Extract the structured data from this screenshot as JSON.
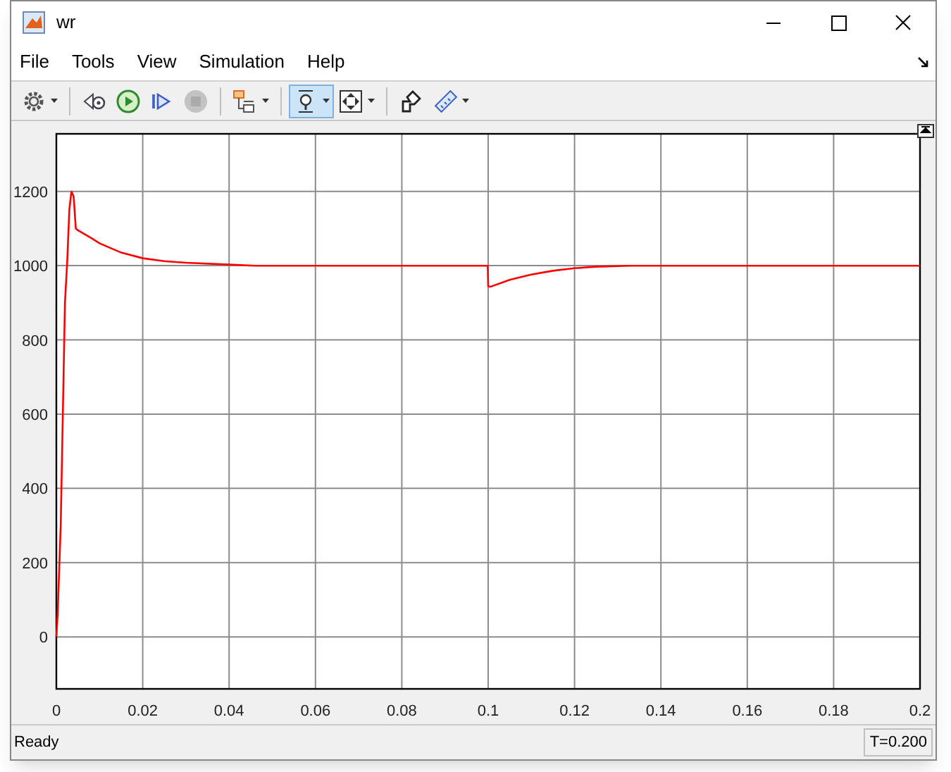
{
  "window": {
    "title": "wr"
  },
  "menu": [
    {
      "label": "File"
    },
    {
      "label": "Tools"
    },
    {
      "label": "View"
    },
    {
      "label": "Simulation"
    },
    {
      "label": "Help"
    }
  ],
  "toolbar": [
    [
      {
        "kind": "settings",
        "dropdown": true,
        "selected": false
      }
    ],
    [
      {
        "kind": "step-back",
        "dropdown": false,
        "selected": false
      },
      {
        "kind": "run",
        "dropdown": false,
        "selected": false
      },
      {
        "kind": "step-forward",
        "dropdown": false,
        "selected": false
      },
      {
        "kind": "stop",
        "dropdown": false,
        "selected": false,
        "disabled": true
      }
    ],
    [
      {
        "kind": "blocks",
        "dropdown": true,
        "selected": false
      }
    ],
    [
      {
        "kind": "zoom",
        "dropdown": true,
        "selected": true
      },
      {
        "kind": "fit",
        "dropdown": true,
        "selected": false
      }
    ],
    [
      {
        "kind": "highlight",
        "dropdown": false,
        "selected": false
      },
      {
        "kind": "measure",
        "dropdown": true,
        "selected": false
      }
    ]
  ],
  "plot": {
    "chart_data": {
      "type": "line",
      "x": [
        0,
        0.0003,
        0.001,
        0.0015,
        0.002,
        0.0025,
        0.003,
        0.0035,
        0.004,
        0.0045,
        0.005,
        0.008,
        0.01,
        0.015,
        0.02,
        0.025,
        0.03,
        0.04,
        0.046,
        0.0999,
        0.1,
        0.1005,
        0.105,
        0.11,
        0.115,
        0.12,
        0.125,
        0.133,
        0.2
      ],
      "series": [
        {
          "color": "#ff0000",
          "values": [
            0,
            60,
            300,
            600,
            900,
            1010,
            1150,
            1200,
            1185,
            1100,
            1095,
            1075,
            1060,
            1035,
            1020,
            1012,
            1008,
            1003,
            1000,
            1000,
            945,
            943,
            962,
            976,
            986,
            993,
            997,
            1000,
            1000
          ]
        }
      ],
      "grid": true,
      "xlim": [
        0,
        0.2
      ],
      "ylim": [
        -140,
        1355
      ],
      "xticks": [
        0,
        0.02,
        0.04,
        0.06,
        0.08,
        0.1,
        0.12,
        0.14,
        0.16,
        0.18,
        0.2
      ],
      "yticks": [
        0,
        200,
        400,
        600,
        800,
        1000,
        1200
      ]
    }
  },
  "status_bar": {
    "text": "Ready",
    "time": "T=0.200"
  }
}
